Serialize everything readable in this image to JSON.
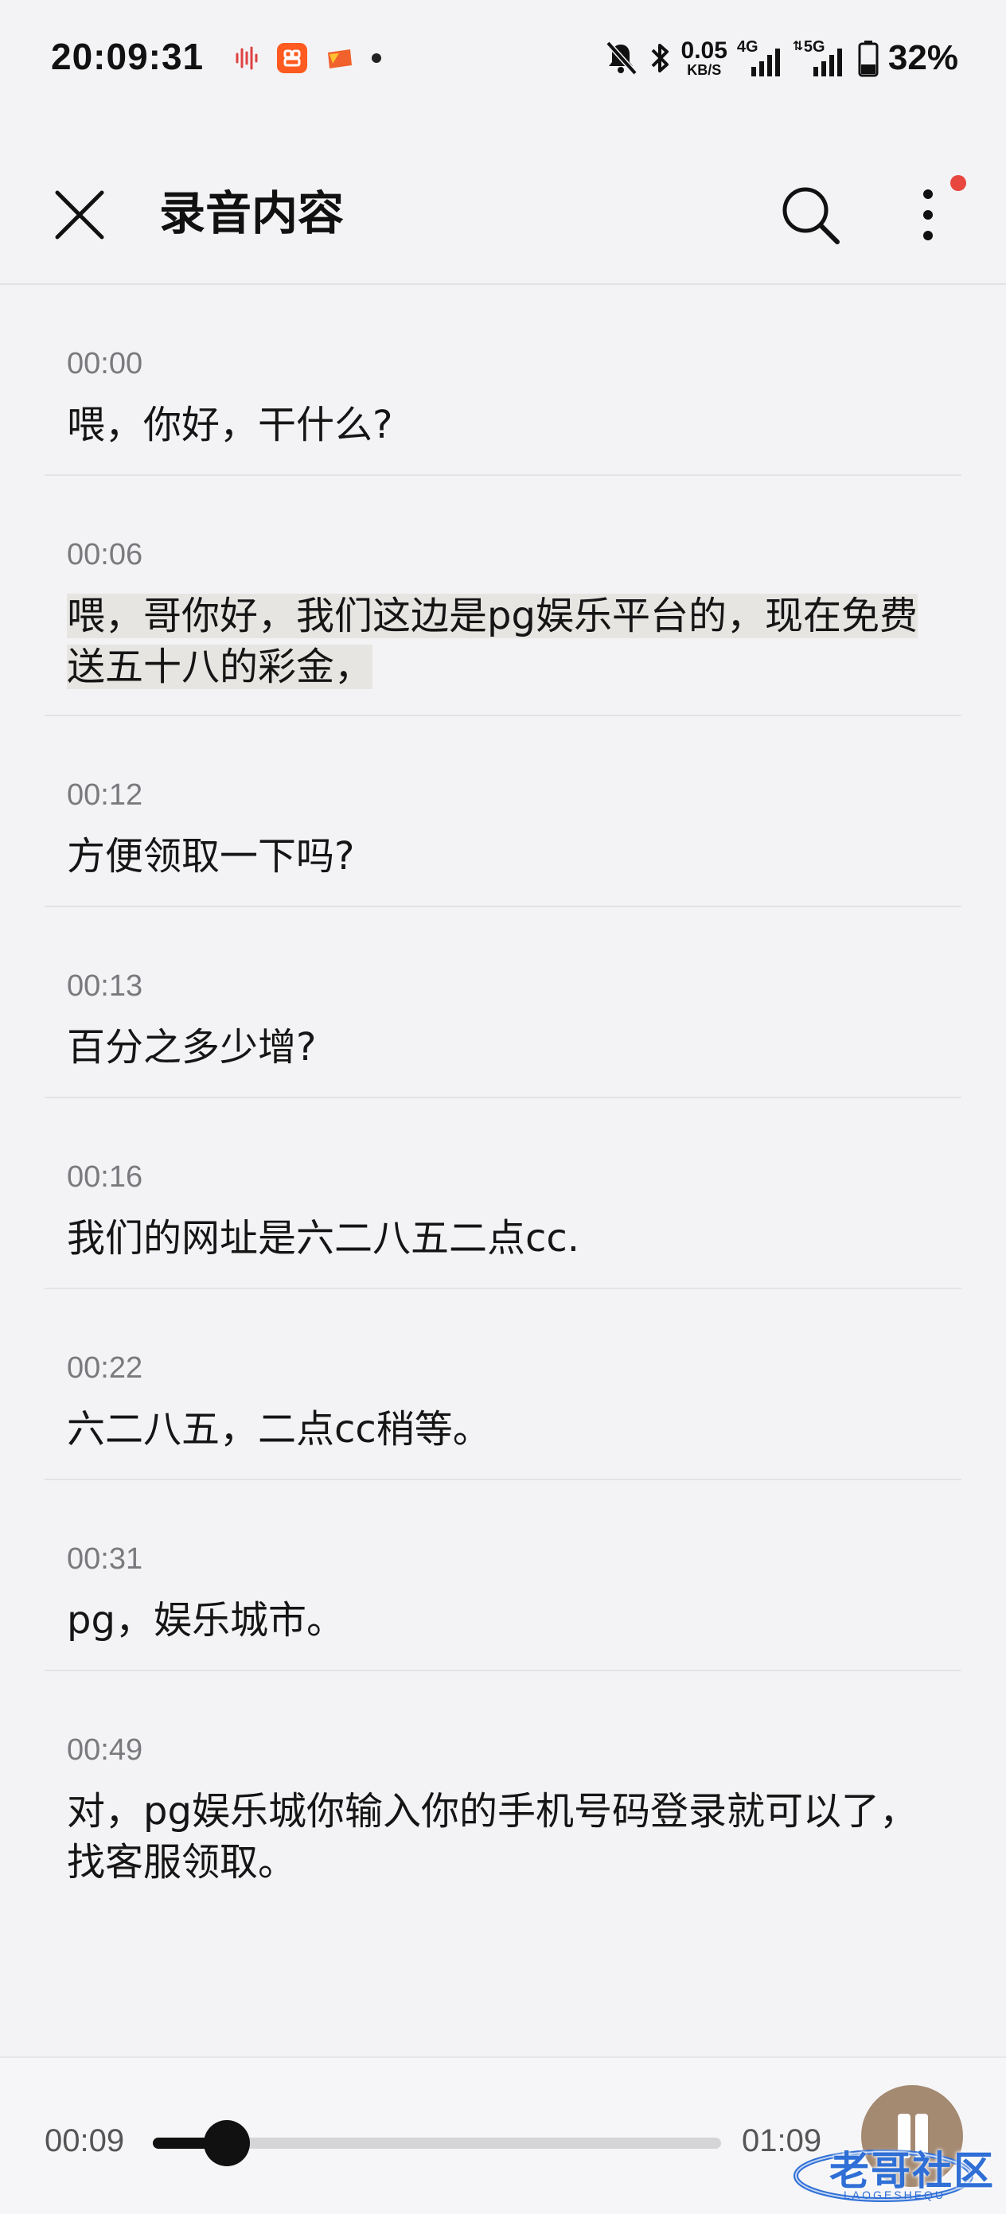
{
  "status_bar": {
    "time": "20:09:31",
    "net_speed_value": "0.05",
    "net_speed_unit": "KB/S",
    "network_4g": "4G",
    "network_5g": "5G",
    "battery_percent": "32%"
  },
  "header": {
    "title": "录音内容"
  },
  "transcript": [
    {
      "time": "00:00",
      "text": "喂，你好，干什么?"
    },
    {
      "time": "00:06",
      "text": "喂，哥你好，我们这边是pg娱乐平台的，现在免费送五十八的彩金，",
      "highlighted": true
    },
    {
      "time": "00:12",
      "text": "方便领取一下吗?"
    },
    {
      "time": "00:13",
      "text": "百分之多少增?"
    },
    {
      "time": "00:16",
      "text": "我们的网址是六二八五二点cc."
    },
    {
      "time": "00:22",
      "text": "六二八五，二点cc稍等。"
    },
    {
      "time": "00:31",
      "text": "pg，娱乐城市。"
    },
    {
      "time": "00:49",
      "text": "对，pg娱乐城你输入你的手机号码登录就可以了，找客服领取。"
    }
  ],
  "player": {
    "current_time": "00:09",
    "total_time": "01:09",
    "progress_fraction": 0.13
  },
  "watermark": {
    "text": "老哥社区",
    "sub": "LAOGESHEQU"
  },
  "colors": {
    "background": "#f3f3f5",
    "highlight": "#e6e5e2",
    "badge_red": "#e8473f",
    "pause_button": "#a58a72"
  }
}
